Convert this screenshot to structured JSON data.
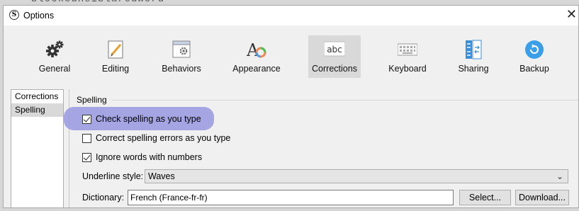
{
  "background_text": "blockedhsiblaredword",
  "window": {
    "app_icon_glyph": "S",
    "title": "Options",
    "close_glyph": "✕"
  },
  "toolbar": {
    "items": [
      {
        "label": "General",
        "icon": "gears-icon"
      },
      {
        "label": "Editing",
        "icon": "pencil-page-icon"
      },
      {
        "label": "Behaviors",
        "icon": "gear-window-icon"
      },
      {
        "label": "Appearance",
        "icon": "font-color-icon"
      },
      {
        "label": "Corrections",
        "icon": "abc-icon",
        "selected": true,
        "icon_text": "abc"
      },
      {
        "label": "Keyboard",
        "icon": "keyboard-icon"
      },
      {
        "label": "Sharing",
        "icon": "sharing-icon"
      },
      {
        "label": "Backup",
        "icon": "backup-icon"
      }
    ]
  },
  "sidebar": {
    "items": [
      {
        "label": "Corrections"
      },
      {
        "label": "Spelling",
        "selected": true
      }
    ]
  },
  "spelling": {
    "group_title": "Spelling",
    "options": [
      {
        "label": "Check spelling as you type",
        "checked": true
      },
      {
        "label": "Correct spelling errors as you type",
        "checked": false
      },
      {
        "label": "Ignore words with numbers",
        "checked": true
      }
    ],
    "underline_label": "Underline style:",
    "underline_value": "Waves",
    "dictionary_label": "Dictionary:",
    "dictionary_value": "French (France-fr-fr)",
    "select_button": "Select...",
    "download_button": "Download..."
  },
  "colors": {
    "highlight": "#9898e0",
    "toolbar_bg": "#f0f0f0",
    "selected_bg": "#d9d9d9",
    "backup_blue": "#3a9ee8"
  }
}
